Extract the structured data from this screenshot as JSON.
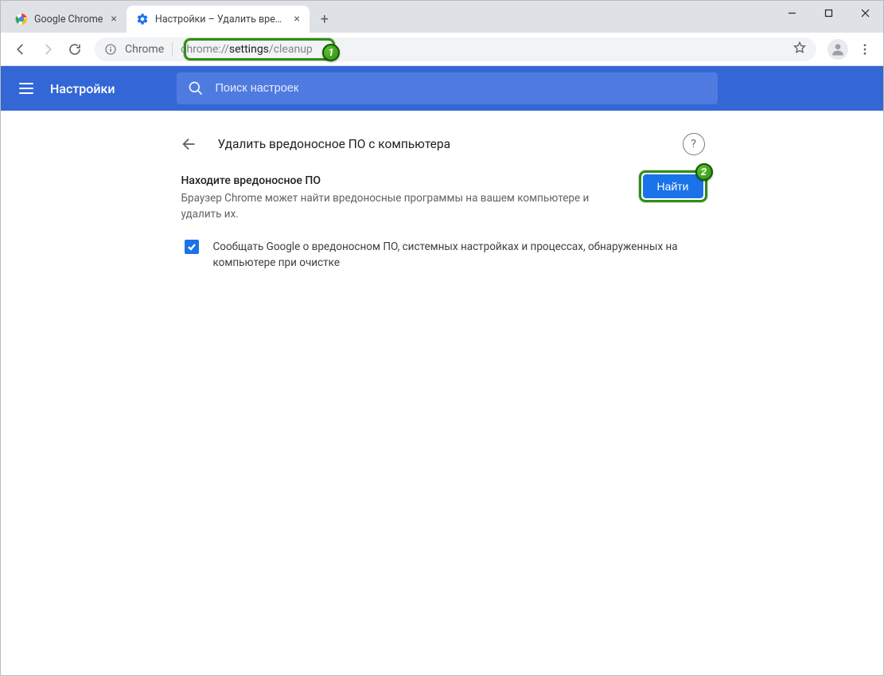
{
  "window": {
    "tabs": [
      {
        "title": "Google Chrome",
        "active": false
      },
      {
        "title": "Настройки – Удалить вредонос…",
        "active": true
      }
    ]
  },
  "toolbar": {
    "site_label": "Chrome",
    "url_prefix": "chrome://",
    "url_bold": "settings",
    "url_suffix": "/cleanup"
  },
  "header": {
    "title": "Настройки",
    "search_placeholder": "Поиск настроек"
  },
  "page": {
    "back_title": "Удалить вредоносное ПО с компьютера",
    "section_heading": "Находите вредоносное ПО",
    "section_desc": "Браузер Chrome может найти вредоносные программы на вашем компьютере и удалить их.",
    "find_label": "Найти",
    "checkbox_label": "Сообщать Google о вредоносном ПО, системных настройках и процессах, обнаруженных на компьютере при очистке"
  },
  "annotations": {
    "c1": "1",
    "c2": "2"
  }
}
